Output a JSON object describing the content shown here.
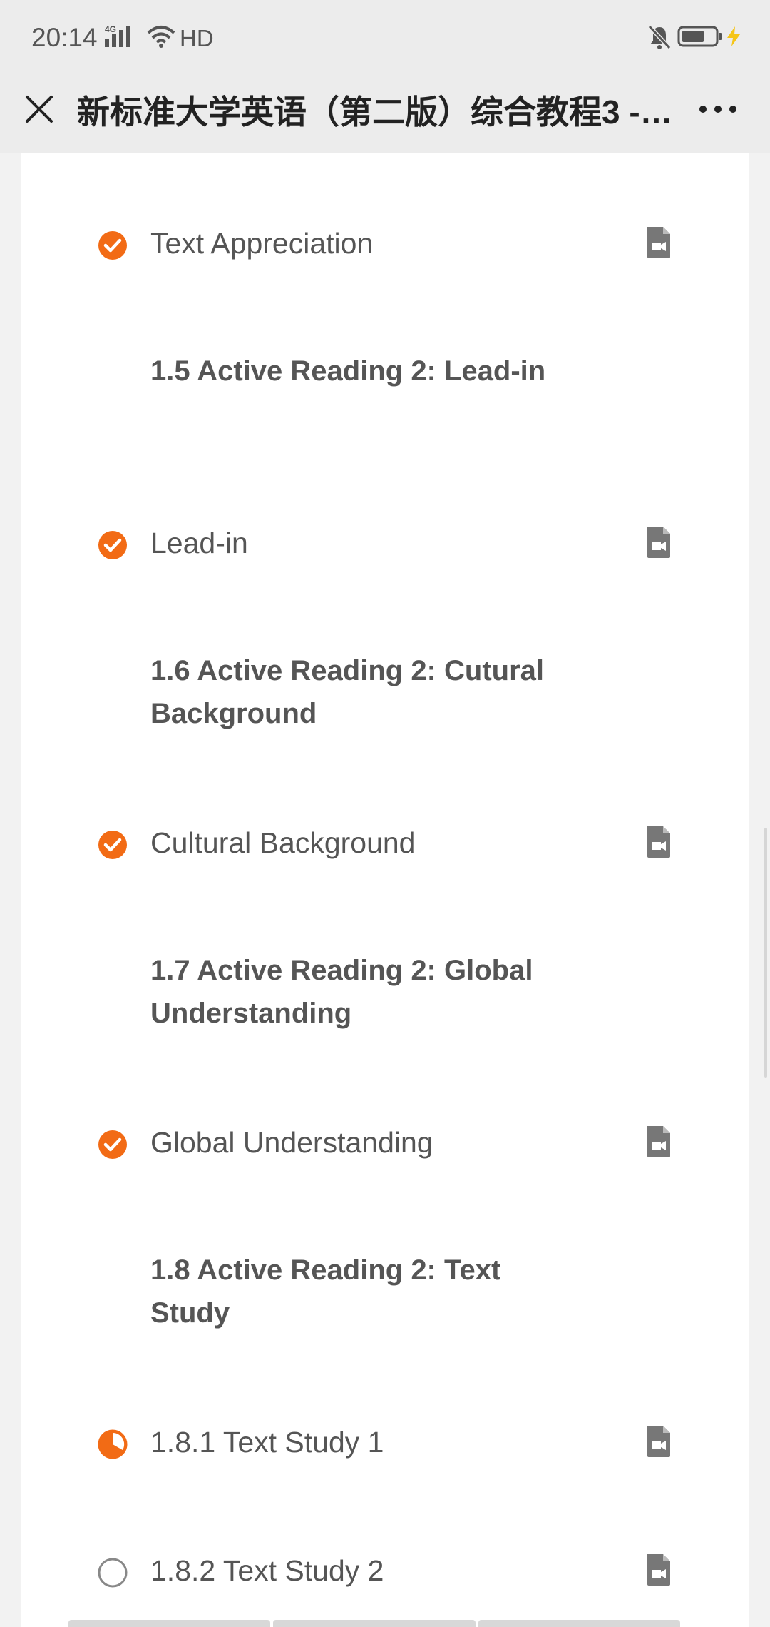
{
  "status_bar": {
    "time": "20:14",
    "network": "4G",
    "hd_label": "HD"
  },
  "nav": {
    "title": "新标准大学英语（第二版）综合教程3 -…"
  },
  "colors": {
    "accent": "#f26b15",
    "text": "#555555",
    "icon": "#777777"
  },
  "lessons": [
    {
      "type": "item",
      "label": "Text Appreciation",
      "status": "complete"
    },
    {
      "type": "section",
      "label": "1.5 Active Reading 2: Lead-in"
    },
    {
      "type": "item",
      "label": "Lead-in",
      "status": "complete"
    },
    {
      "type": "section",
      "label": "1.6 Active Reading 2: Cutural Background"
    },
    {
      "type": "item",
      "label": "Cultural Background",
      "status": "complete"
    },
    {
      "type": "section",
      "label": "1.7 Active Reading 2: Global Understanding"
    },
    {
      "type": "item",
      "label": "Global Understanding",
      "status": "complete"
    },
    {
      "type": "section",
      "label": "1.8 Active Reading 2: Text Study"
    },
    {
      "type": "item",
      "label": "1.8.1 Text Study 1",
      "status": "partial"
    },
    {
      "type": "item",
      "label": "1.8.2 Text Study 2",
      "status": "not-started"
    }
  ]
}
